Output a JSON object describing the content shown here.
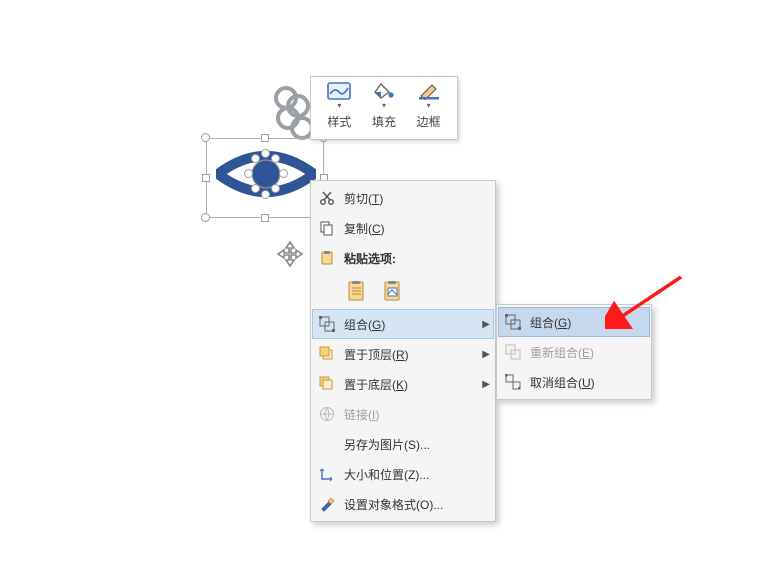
{
  "mini_toolbar": {
    "style": "样式",
    "fill": "填充",
    "border": "边框"
  },
  "context_menu": {
    "cut": {
      "label": "剪切(",
      "key": "T",
      "tail": ")"
    },
    "copy": {
      "label": "复制(",
      "key": "C",
      "tail": ")"
    },
    "paste_header": "粘贴选项:",
    "group": {
      "label": "组合(",
      "key": "G",
      "tail": ")"
    },
    "front": {
      "label": "置于顶层(",
      "key": "R",
      "tail": ")"
    },
    "back": {
      "label": "置于底层(",
      "key": "K",
      "tail": ")"
    },
    "link": {
      "label": "链接(",
      "key": "I",
      "tail": ")"
    },
    "saveimg": "另存为图片(S)...",
    "sizepos": "大小和位置(Z)...",
    "format": "设置对象格式(O)..."
  },
  "submenu": {
    "group": {
      "label": "组合(",
      "key": "G",
      "tail": ")"
    },
    "regroup": {
      "label": "重新组合(",
      "key": "E",
      "tail": ")"
    },
    "ungroup": {
      "label": "取消组合(",
      "key": "U",
      "tail": ")"
    }
  },
  "colors": {
    "accent": "#2f5597",
    "accent_line": "#4472c4"
  }
}
